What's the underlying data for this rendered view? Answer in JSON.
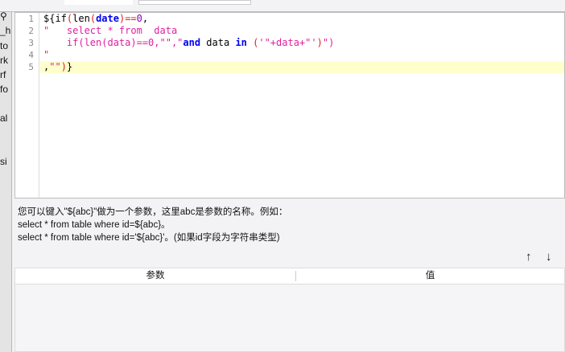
{
  "sidebar": {
    "items": [
      "_h",
      "to",
      "rk",
      "rf",
      "fo",
      "al",
      "si"
    ]
  },
  "editor": {
    "line_numbers": [
      "1",
      "2",
      "3",
      "4",
      "5"
    ]
  },
  "help": {
    "line1": "您可以键入\"${abc}\"做为一个参数，这里abc是参数的名称。例如：",
    "line2": "select * from table where id=${abc}。",
    "line3": "select * from table where id='${abc}'。(如果id字段为字符串类型)"
  },
  "buttons": {
    "up": "↑",
    "down": "↓"
  },
  "table": {
    "headers": [
      "参数",
      "值"
    ]
  }
}
